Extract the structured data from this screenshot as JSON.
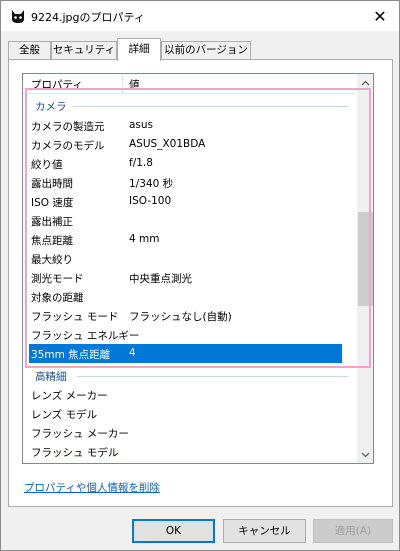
{
  "window": {
    "title": "9224.jpgのプロパティ"
  },
  "tabs": [
    {
      "label": "全般"
    },
    {
      "label": "セキュリティ"
    },
    {
      "label": "詳細"
    },
    {
      "label": "以前のバージョン"
    }
  ],
  "list": {
    "columns": {
      "property": "プロパティ",
      "value": "値"
    },
    "groups": {
      "camera": "カメラ",
      "advanced": "高精細"
    },
    "camera_rows": [
      {
        "name": "カメラの製造元",
        "value": "asus"
      },
      {
        "name": "カメラのモデル",
        "value": "ASUS_X01BDA"
      },
      {
        "name": "絞り値",
        "value": "f/1.8"
      },
      {
        "name": "露出時間",
        "value": "1/340 秒"
      },
      {
        "name": "ISO 速度",
        "value": "ISO-100"
      },
      {
        "name": "露出補正",
        "value": ""
      },
      {
        "name": "焦点距離",
        "value": "4 mm"
      },
      {
        "name": "最大絞り",
        "value": ""
      },
      {
        "name": "測光モード",
        "value": "中央重点測光"
      },
      {
        "name": "対象の距離",
        "value": ""
      },
      {
        "name": "フラッシュ モード",
        "value": "フラッシュなし(自動)"
      },
      {
        "name": "フラッシュ エネルギー",
        "value": ""
      },
      {
        "name": "35mm 焦点距離",
        "value": "4"
      }
    ],
    "advanced_rows": [
      {
        "name": "レンズ メーカー",
        "value": ""
      },
      {
        "name": "レンズ モデル",
        "value": ""
      },
      {
        "name": "フラッシュ メーカー",
        "value": ""
      },
      {
        "name": "フラッシュ モデル",
        "value": ""
      }
    ],
    "selected_row": "35mm 焦点距離"
  },
  "remove_link": "プロパティや個人情報を削除",
  "buttons": {
    "ok": "OK",
    "cancel": "キャンセル",
    "apply": "適用(A)"
  },
  "colors": {
    "selection": "#0078d7",
    "highlight_box": "#f4a3c8",
    "link": "#0066cc",
    "group_label": "#1e4b8f"
  }
}
